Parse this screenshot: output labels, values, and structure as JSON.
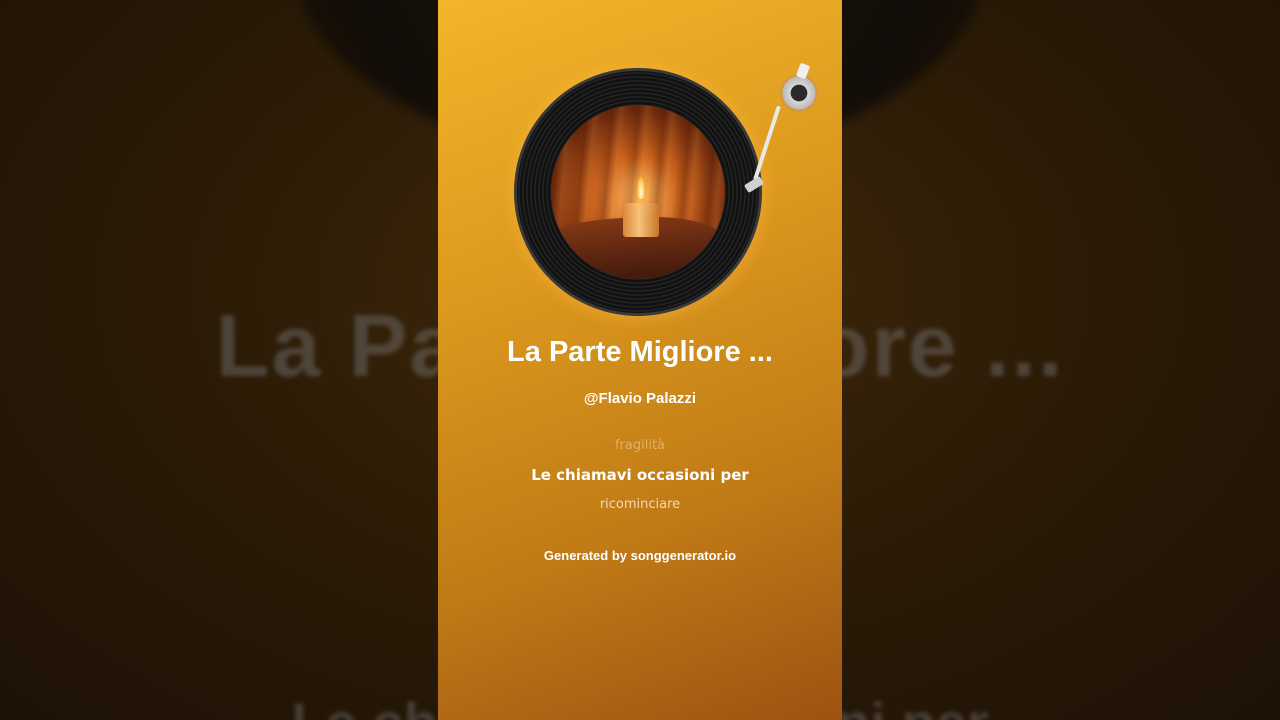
{
  "song": {
    "title": "La Parte Migliore ...",
    "artist": "@Flavio Palazzi"
  },
  "lyrics": {
    "previous": "fragilità",
    "current": "Le chiamavi occasioni per",
    "next": "ricominciare"
  },
  "credit": "Generated by songgenerator.io",
  "background": {
    "title": "La Parte Migliore ...",
    "lyric": "Le chiamavi occasioni per"
  },
  "colors": {
    "card_top": "#f3b52a",
    "card_bottom": "#9e5212",
    "text": "#ffffff"
  }
}
